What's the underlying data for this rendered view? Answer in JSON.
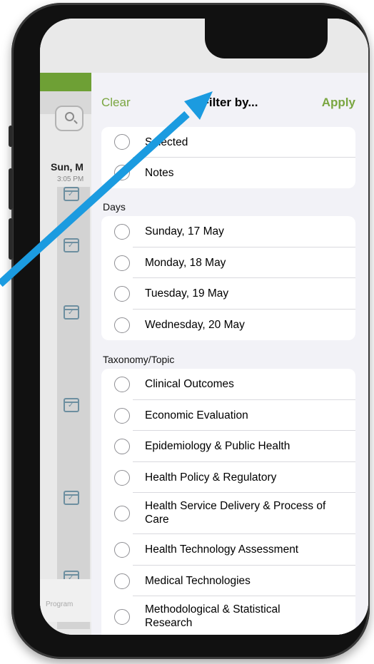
{
  "colors": {
    "accent_green": "#7aa641",
    "topbar_green": "#6ea035",
    "arrow_blue": "#1b9be0"
  },
  "background": {
    "date_text": "Sun, M",
    "time_text": "3:05 PM",
    "tab_label": "Program"
  },
  "header": {
    "clear_label": "Clear",
    "title": "Filter by...",
    "apply_label": "Apply"
  },
  "general": {
    "items": [
      {
        "label": "Selected",
        "selected": false
      },
      {
        "label": "Notes",
        "selected": false
      }
    ]
  },
  "days": {
    "section_label": "Days",
    "items": [
      {
        "label": "Sunday, 17 May",
        "selected": false
      },
      {
        "label": "Monday, 18 May",
        "selected": false
      },
      {
        "label": "Tuesday, 19 May",
        "selected": false
      },
      {
        "label": "Wednesday, 20 May",
        "selected": false
      }
    ]
  },
  "topics": {
    "section_label": "Taxonomy/Topic",
    "items": [
      {
        "label": "Clinical Outcomes",
        "selected": false
      },
      {
        "label": "Economic Evaluation",
        "selected": false
      },
      {
        "label": "Epidemiology & Public Health",
        "selected": false
      },
      {
        "label": "Health Policy & Regulatory",
        "selected": false
      },
      {
        "label": "Health Service Delivery & Process of Care",
        "selected": false
      },
      {
        "label": "Health Technology Assessment",
        "selected": false
      },
      {
        "label": "Medical Technologies",
        "selected": false
      },
      {
        "label": "Methodological & Statistical Research",
        "selected": false
      }
    ]
  }
}
